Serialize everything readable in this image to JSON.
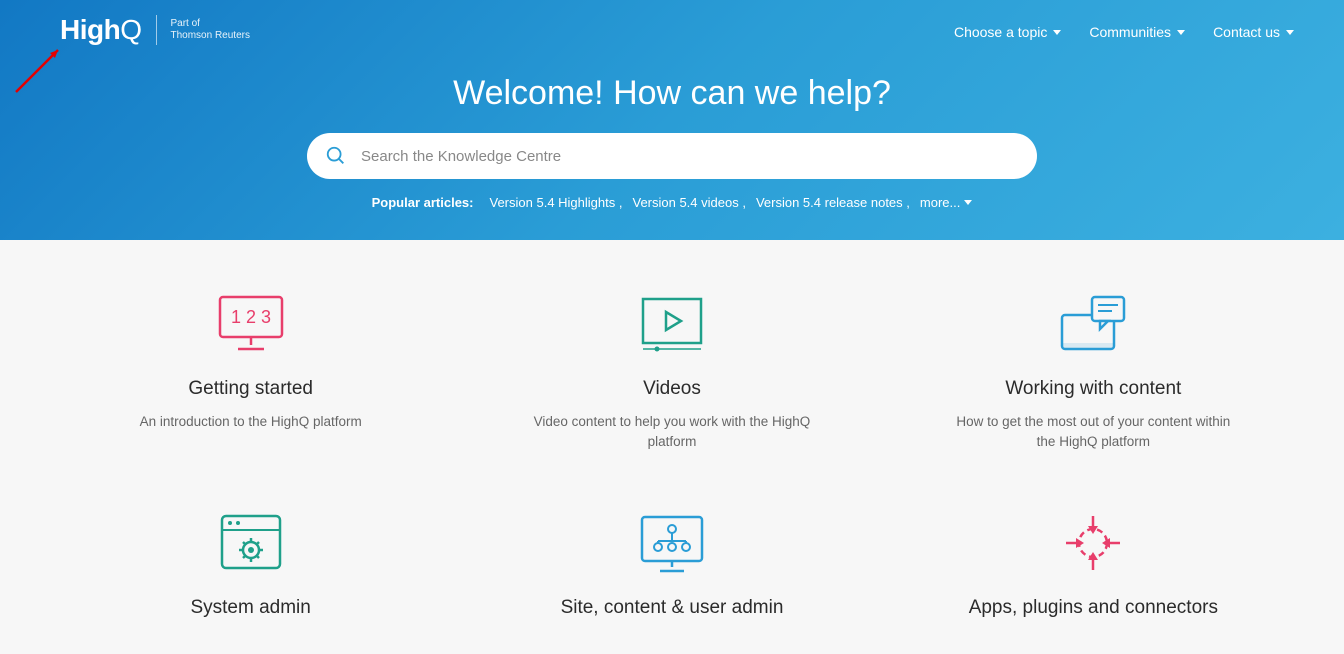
{
  "logo": {
    "text": "HighQ",
    "sub1": "Part of",
    "sub2": "Thomson Reuters"
  },
  "nav": [
    {
      "label": "Choose a topic"
    },
    {
      "label": "Communities"
    },
    {
      "label": "Contact us"
    }
  ],
  "welcome": "Welcome! How can we help?",
  "search": {
    "placeholder": "Search the Knowledge Centre"
  },
  "popular": {
    "label": "Popular articles:",
    "links": [
      "Version 5.4 Highlights",
      "Version 5.4 videos",
      "Version 5.4 release notes"
    ],
    "more": "more..."
  },
  "cards": [
    {
      "title": "Getting started",
      "desc": "An introduction to the HighQ platform"
    },
    {
      "title": "Videos",
      "desc": "Video content to help you work with the HighQ platform"
    },
    {
      "title": "Working with content",
      "desc": "How to get the most out of your content within the HighQ platform"
    },
    {
      "title": "System admin",
      "desc": ""
    },
    {
      "title": "Site, content & user admin",
      "desc": ""
    },
    {
      "title": "Apps, plugins and connectors",
      "desc": ""
    }
  ]
}
